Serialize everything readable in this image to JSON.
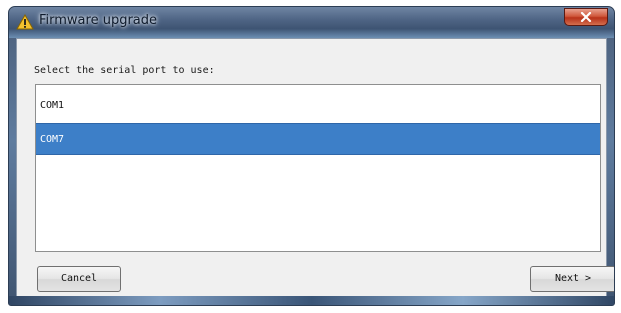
{
  "window": {
    "title": "Firmware upgrade",
    "title_icon": "warning-icon",
    "close_icon": "close-icon"
  },
  "dialog": {
    "prompt": "Select the serial port to use:",
    "ports": [
      {
        "label": "COM1",
        "selected": false
      },
      {
        "label": "COM7",
        "selected": true
      }
    ],
    "buttons": {
      "cancel": "Cancel",
      "next": "Next >"
    }
  },
  "colors": {
    "selection": "#3d7fc8",
    "titlebar": "#4f6585"
  }
}
